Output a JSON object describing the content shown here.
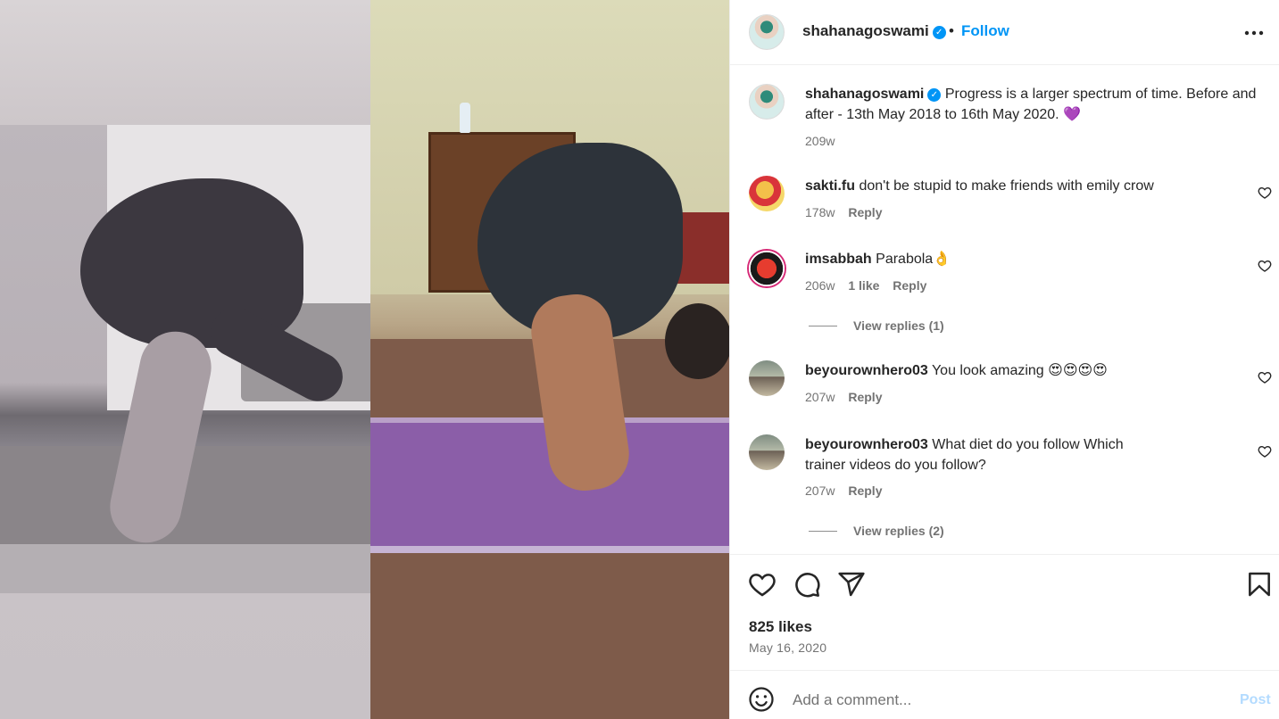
{
  "post": {
    "username": "shahanagoswami",
    "follow_label": "Follow",
    "separator": "•",
    "verified_icon": "verified-badge-icon",
    "more_icon": "more-options-icon"
  },
  "caption": {
    "username": "shahanagoswami",
    "text": "Progress is a larger spectrum of time. Before and after - 13th May 2018 to 16th May 2020. 💜",
    "time": "209w"
  },
  "comments": [
    {
      "username": "sakti.fu",
      "text": "don't be stupid to make friends with emily crow",
      "time": "178w",
      "likes": "",
      "reply_label": "Reply"
    },
    {
      "username": "imsabbah",
      "text": "Parabola👌",
      "time": "206w",
      "likes": "1 like",
      "reply_label": "Reply",
      "view_replies": "View replies (1)"
    },
    {
      "username": "beyourownhero03",
      "text": "You look amazing 😍😍😍😍",
      "time": "207w",
      "likes": "",
      "reply_label": "Reply"
    },
    {
      "username": "beyourownhero03",
      "text": "What diet do you follow Which trainer videos do you follow?",
      "time": "207w",
      "likes": "",
      "reply_label": "Reply",
      "view_replies": "View replies (2)"
    }
  ],
  "actions": {
    "likes": "825 likes",
    "date": "May 16, 2020",
    "icons": [
      "heart-icon",
      "comment-icon",
      "share-icon",
      "bookmark-icon"
    ]
  },
  "composer": {
    "placeholder": "Add a comment...",
    "post_label": "Post",
    "emoji_icon": "emoji-icon"
  },
  "colors": {
    "accent": "#0095f6",
    "post_disabled": "#b3dbff",
    "secondary_text": "#737373"
  }
}
